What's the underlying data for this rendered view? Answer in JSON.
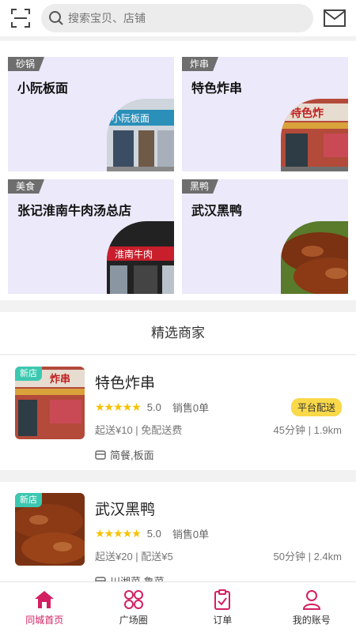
{
  "header": {
    "search_placeholder": "搜索宝贝、店铺",
    "scan_icon": "scan-icon",
    "mail_icon": "mail-icon"
  },
  "categories": [
    {
      "tag": "砂锅",
      "title": "小阮板面",
      "photo_text": "小阮板面"
    },
    {
      "tag": "炸串",
      "title": "特色炸串",
      "photo_text": "特色炸"
    },
    {
      "tag": "美食",
      "title": "张记淮南牛肉汤总店",
      "photo_text": "淮南牛肉"
    },
    {
      "tag": "黑鸭",
      "title": "武汉黑鸭",
      "photo_text": ""
    }
  ],
  "section": {
    "title": "精选商家"
  },
  "shops": [
    {
      "badge": "新店",
      "name": "特色炸串",
      "rating_stars": "★★★★★",
      "rating": "5.0",
      "sales": "销售0单",
      "delivery_badge": "平台配送",
      "fee": "起送¥10 | 免配送费",
      "eta": "45分钟 | 1.9km",
      "categories": "简餐,板面",
      "photo_text": "炸串"
    },
    {
      "badge": "新店",
      "name": "武汉黑鸭",
      "rating_stars": "★★★★★",
      "rating": "5.0",
      "sales": "销售0单",
      "delivery_badge": "",
      "fee": "起送¥20 | 配送¥5",
      "eta": "50分钟 | 2.4km",
      "categories": "川湘菜,鲁菜",
      "photo_text": ""
    }
  ],
  "nav": [
    {
      "label": "同城首页",
      "icon": "home-icon",
      "active": true
    },
    {
      "label": "广场圈",
      "icon": "grid-icon",
      "active": false
    },
    {
      "label": "订单",
      "icon": "order-icon",
      "active": false
    },
    {
      "label": "我的账号",
      "icon": "user-icon",
      "active": false
    }
  ],
  "colors": {
    "accent": "#d21f61",
    "card_bg": "#ece9fa",
    "new_badge": "#3cc8b0",
    "delivery_badge": "#f9d84a"
  }
}
